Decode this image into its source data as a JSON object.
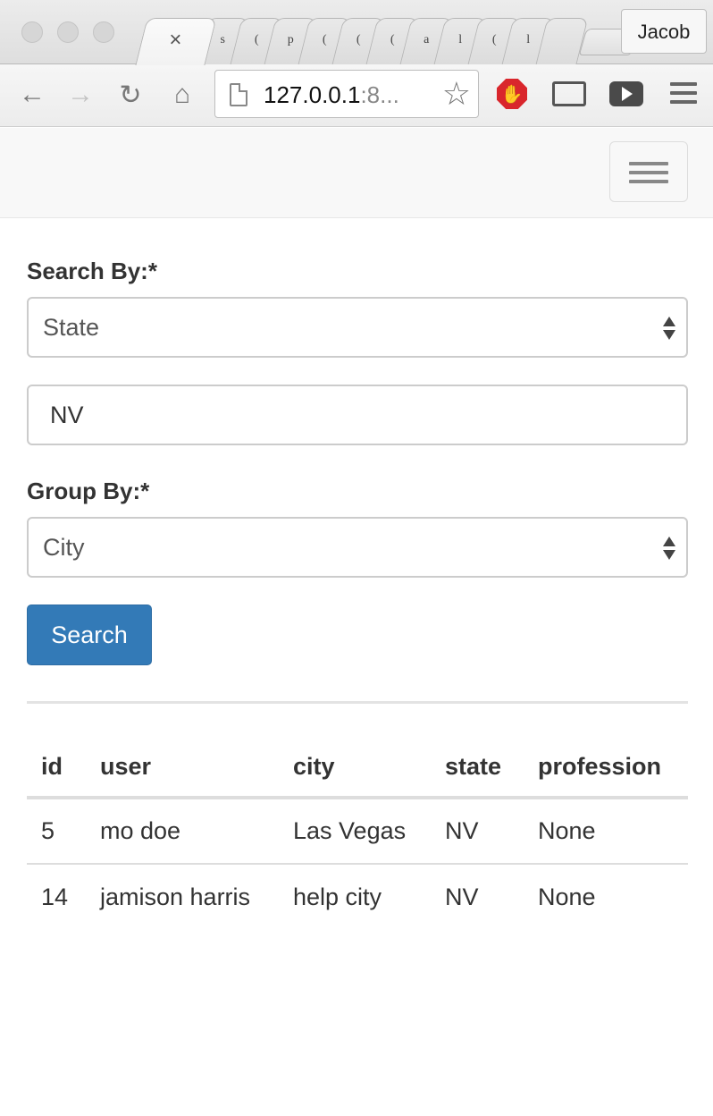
{
  "browser": {
    "tabs": [
      {
        "label": "",
        "active": true,
        "close": "×"
      },
      {
        "label": "s"
      },
      {
        "label": "("
      },
      {
        "label": "p"
      },
      {
        "label": "("
      },
      {
        "label": "("
      },
      {
        "label": "("
      },
      {
        "label": "a"
      },
      {
        "label": "l"
      },
      {
        "label": "("
      },
      {
        "label": "l"
      }
    ],
    "profile_name": "Jacob",
    "url_host": "127.0.0.1",
    "url_rest": ":8..."
  },
  "form": {
    "search_by_label": "Search By:*",
    "search_by_value": "State",
    "search_value": "NV",
    "group_by_label": "Group By:*",
    "group_by_value": "City",
    "search_button": "Search"
  },
  "table": {
    "headers": [
      "id",
      "user",
      "city",
      "state",
      "profession"
    ],
    "rows": [
      [
        "5",
        "mo doe",
        "Las Vegas",
        "NV",
        "None"
      ],
      [
        "14",
        "jamison harris",
        "help city",
        "NV",
        "None"
      ]
    ]
  },
  "colors": {
    "primary_button": "#337ab7",
    "stop_extension": "#d9262c"
  }
}
